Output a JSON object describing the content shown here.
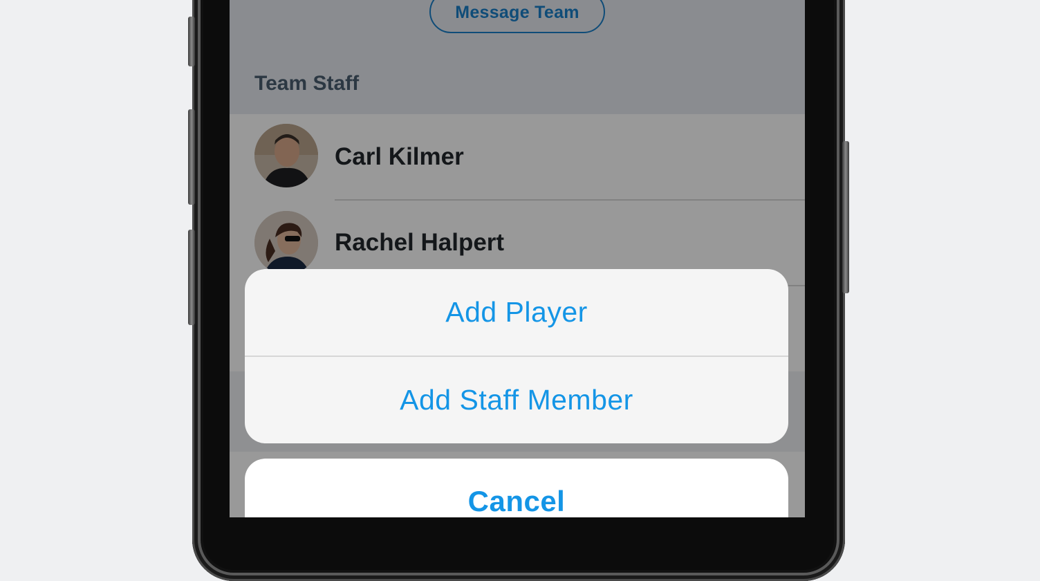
{
  "header": {
    "message_team_label": "Message Team"
  },
  "staff_section": {
    "title": "Team Staff",
    "members": [
      {
        "name": "Carl Kilmer"
      },
      {
        "name": "Rachel Halpert"
      }
    ]
  },
  "action_sheet": {
    "options": [
      "Add Player",
      "Add Staff Member"
    ],
    "cancel_label": "Cancel"
  },
  "colors": {
    "accent": "#1495e6",
    "accent_dark": "#1a7fc9"
  }
}
